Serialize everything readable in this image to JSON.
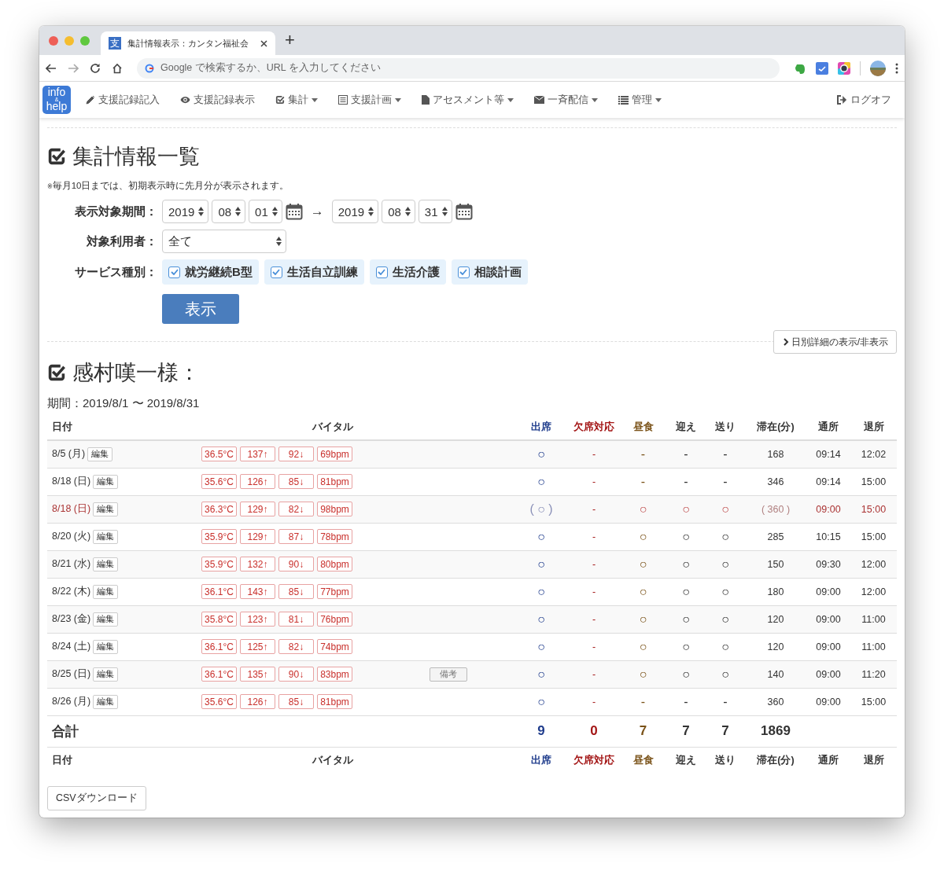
{
  "browser": {
    "tab_favicon": "支",
    "tab_title": "集計情報表示：カンタン福祉会",
    "new_tab": "+",
    "address_placeholder": "Google で検索するか、URL を入力してください"
  },
  "nav": {
    "logo": [
      "info",
      "&",
      "help"
    ],
    "items": [
      {
        "label": "支援記録記入",
        "dropdown": false
      },
      {
        "label": "支援記録表示",
        "dropdown": false
      },
      {
        "label": "集計",
        "dropdown": true
      },
      {
        "label": "支援計画",
        "dropdown": true
      },
      {
        "label": "アセスメント等",
        "dropdown": true
      },
      {
        "label": "一斉配信",
        "dropdown": true
      },
      {
        "label": "管理",
        "dropdown": true
      }
    ],
    "logout": "ログオフ"
  },
  "filter": {
    "title": "集計情報一覧",
    "note_mark": "※",
    "note": "毎月10日までは、初期表示時に先月分が表示されます。",
    "period_label": "表示対象期間：",
    "from": [
      "2019",
      "08",
      "01"
    ],
    "arrow": "→",
    "to": [
      "2019",
      "08",
      "31"
    ],
    "user_label": "対象利用者：",
    "user_value": "全て",
    "service_label": "サービス種別：",
    "services": [
      {
        "label": "就労継続B型",
        "checked": true
      },
      {
        "label": "生活自立訓練",
        "checked": true
      },
      {
        "label": "生活介護",
        "checked": true
      },
      {
        "label": "相談計画",
        "checked": true
      }
    ],
    "submit": "表示",
    "toggle": "日別詳細の表示/非表示"
  },
  "report": {
    "title": "感村嘆一様：",
    "period": "期間：2019/8/1 〜 2019/8/31"
  },
  "table": {
    "columns": [
      {
        "label": "日付"
      },
      {
        "label": "バイタル"
      },
      {
        "label": "出席",
        "color": "#1f3c8c"
      },
      {
        "label": "欠席対応",
        "color": "#a31515"
      },
      {
        "label": "昼食",
        "color": "#7a5218"
      },
      {
        "label": "迎え"
      },
      {
        "label": "送り"
      },
      {
        "label": "滞在(分)"
      },
      {
        "label": "通所"
      },
      {
        "label": "退所"
      }
    ],
    "rows": [
      {
        "date": "8/5 (月)",
        "edit": "編集",
        "absent": false,
        "vitals": [
          "36.5°C",
          "137↑",
          "92↓",
          "69bpm"
        ],
        "attend": "○",
        "absence": "-",
        "lunch": "-",
        "pickup": "-",
        "dropoff": "-",
        "stay": "168",
        "in": "09:14",
        "out": "12:02"
      },
      {
        "date": "8/18 (日)",
        "edit": "編集",
        "absent": false,
        "vitals": [
          "35.6°C",
          "126↑",
          "85↓",
          "81bpm"
        ],
        "attend": "○",
        "absence": "-",
        "lunch": "-",
        "pickup": "-",
        "dropoff": "-",
        "stay": "346",
        "in": "09:14",
        "out": "15:00"
      },
      {
        "date": "8/18 (日)",
        "edit": "編集",
        "absent": true,
        "vitals": [
          "36.3°C",
          "129↑",
          "82↓",
          "98bpm"
        ],
        "attend": "( ○ )",
        "absence": "-",
        "lunch": "○",
        "pickup": "○",
        "dropoff": "○",
        "stay": "( 360 )",
        "in": "09:00",
        "out": "15:00"
      },
      {
        "date": "8/20 (火)",
        "edit": "編集",
        "absent": false,
        "vitals": [
          "35.9°C",
          "129↑",
          "87↓",
          "78bpm"
        ],
        "attend": "○",
        "absence": "-",
        "lunch": "○",
        "pickup": "○",
        "dropoff": "○",
        "stay": "285",
        "in": "10:15",
        "out": "15:00"
      },
      {
        "date": "8/21 (水)",
        "edit": "編集",
        "absent": false,
        "vitals": [
          "35.9°C",
          "132↑",
          "90↓",
          "80bpm"
        ],
        "attend": "○",
        "absence": "-",
        "lunch": "○",
        "pickup": "○",
        "dropoff": "○",
        "stay": "150",
        "in": "09:30",
        "out": "12:00"
      },
      {
        "date": "8/22 (木)",
        "edit": "編集",
        "absent": false,
        "vitals": [
          "36.1°C",
          "143↑",
          "85↓",
          "77bpm"
        ],
        "attend": "○",
        "absence": "-",
        "lunch": "○",
        "pickup": "○",
        "dropoff": "○",
        "stay": "180",
        "in": "09:00",
        "out": "12:00"
      },
      {
        "date": "8/23 (金)",
        "edit": "編集",
        "absent": false,
        "vitals": [
          "35.8°C",
          "123↑",
          "81↓",
          "76bpm"
        ],
        "attend": "○",
        "absence": "-",
        "lunch": "○",
        "pickup": "○",
        "dropoff": "○",
        "stay": "120",
        "in": "09:00",
        "out": "11:00"
      },
      {
        "date": "8/24 (土)",
        "edit": "編集",
        "absent": false,
        "vitals": [
          "36.1°C",
          "125↑",
          "82↓",
          "74bpm"
        ],
        "attend": "○",
        "absence": "-",
        "lunch": "○",
        "pickup": "○",
        "dropoff": "○",
        "stay": "120",
        "in": "09:00",
        "out": "11:00"
      },
      {
        "date": "8/25 (日)",
        "edit": "編集",
        "absent": false,
        "vitals": [
          "36.1°C",
          "135↑",
          "90↓",
          "83bpm"
        ],
        "note": "備考",
        "attend": "○",
        "absence": "-",
        "lunch": "○",
        "pickup": "○",
        "dropoff": "○",
        "stay": "140",
        "in": "09:00",
        "out": "11:20"
      },
      {
        "date": "8/26 (月)",
        "edit": "編集",
        "absent": false,
        "vitals": [
          "35.6°C",
          "126↑",
          "85↓",
          "81bpm"
        ],
        "attend": "○",
        "absence": "-",
        "lunch": "-",
        "pickup": "-",
        "dropoff": "-",
        "stay": "360",
        "in": "09:00",
        "out": "15:00"
      }
    ],
    "totals": {
      "label": "合計",
      "attend": "9",
      "absence": "0",
      "lunch": "7",
      "pickup": "7",
      "dropoff": "7",
      "stay": "1869"
    },
    "footer_columns": [
      {
        "label": "日付"
      },
      {
        "label": "バイタル"
      },
      {
        "label": "出席",
        "color": "#1f3c8c"
      },
      {
        "label": "欠席対応",
        "color": "#a31515"
      },
      {
        "label": "昼食",
        "color": "#7a5218"
      },
      {
        "label": "迎え"
      },
      {
        "label": "送り"
      },
      {
        "label": "滞在(分)"
      },
      {
        "label": "通所"
      },
      {
        "label": "退所"
      }
    ]
  },
  "csv_button": "CSVダウンロード"
}
